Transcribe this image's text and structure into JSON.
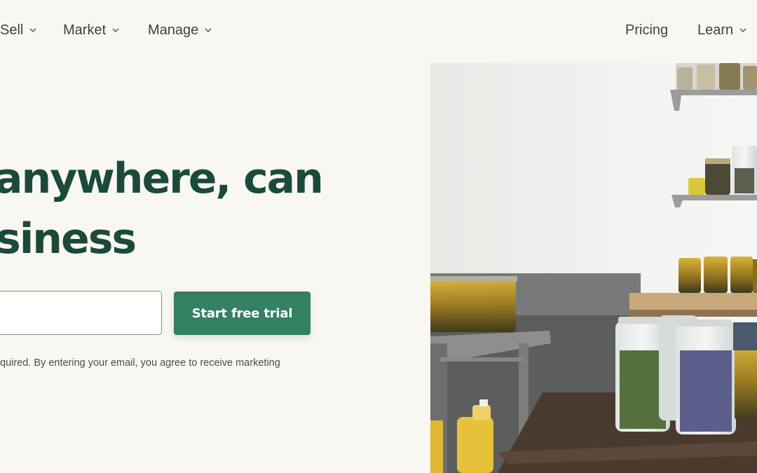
{
  "nav": {
    "left_items": [
      {
        "label": "Sell",
        "icon": "chevron-down-icon"
      },
      {
        "label": "Market",
        "icon": "chevron-down-icon"
      },
      {
        "label": "Manage",
        "icon": "chevron-down-icon"
      }
    ],
    "right_items": [
      {
        "label": "Pricing"
      },
      {
        "label": "Learn",
        "icon": "chevron-down-icon"
      }
    ]
  },
  "hero": {
    "headline_lines": [
      "anywhere, can",
      "siness"
    ],
    "email_placeholder": "",
    "cta_label": "Start free trial",
    "disclaimer": "quired. By entering your email, you agree to receive marketing"
  },
  "photo": {
    "subject": "jars-on-shelves"
  },
  "colors": {
    "background": "#f9f7f1",
    "headline": "#1c4a3a",
    "cta": "#338062",
    "nav_text": "#3f4146"
  }
}
